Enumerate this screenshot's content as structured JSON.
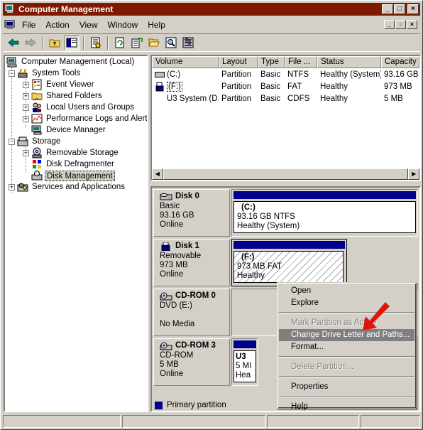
{
  "window": {
    "title": "Computer Management"
  },
  "menu": {
    "items": [
      "File",
      "Action",
      "View",
      "Window",
      "Help"
    ]
  },
  "toolbar": {
    "icons": [
      "back-icon",
      "forward-icon",
      "up-folder-icon",
      "show-hide-tree-icon",
      "properties-icon",
      "refresh-icon",
      "export-list-icon",
      "open-icon",
      "search-icon",
      "settings-icon"
    ]
  },
  "tree": {
    "root": "Computer Management (Local)",
    "system_tools": "System Tools",
    "event_viewer": "Event Viewer",
    "shared_folders": "Shared Folders",
    "local_users": "Local Users and Groups",
    "perf_logs": "Performance Logs and Alerts",
    "device_manager": "Device Manager",
    "storage": "Storage",
    "removable_storage": "Removable Storage",
    "disk_defrag": "Disk Defragmenter",
    "disk_mgmt": "Disk Management",
    "services_apps": "Services and Applications"
  },
  "volumes": {
    "columns": [
      "Volume",
      "Layout",
      "Type",
      "File ...",
      "Status",
      "Capacity"
    ],
    "rows": [
      {
        "volume": "(C:)",
        "layout": "Partition",
        "type": "Basic",
        "fs": "NTFS",
        "status": "Healthy (System)",
        "capacity": "93.16 GB"
      },
      {
        "volume": "(F:)",
        "layout": "Partition",
        "type": "Basic",
        "fs": "FAT",
        "status": "Healthy",
        "capacity": "973 MB"
      },
      {
        "volume": "U3 System (D:)",
        "layout": "Partition",
        "type": "Basic",
        "fs": "CDFS",
        "status": "Healthy",
        "capacity": "5 MB"
      }
    ]
  },
  "disks": {
    "d0": {
      "name": "Disk 0",
      "kind": "Basic",
      "size": "93.16 GB",
      "state": "Online",
      "part_title": "(C:)",
      "part_size": "93.16 GB NTFS",
      "part_status": "Healthy (System)"
    },
    "d1": {
      "name": "Disk 1",
      "kind": "Removable",
      "size": "973 MB",
      "state": "Online",
      "part_title": "(F:)",
      "part_size": "973 MB FAT",
      "part_status": "Healthy"
    },
    "cd0": {
      "name": "CD-ROM 0",
      "kind": "DVD (E:)",
      "state": "No Media"
    },
    "cd3": {
      "name": "CD-ROM 3",
      "kind": "CD-ROM",
      "size": "5 MB",
      "state": "Online",
      "part_title": "U3",
      "part_size": "5 MI",
      "part_status": "Hea"
    }
  },
  "legend": {
    "primary": "Primary partition"
  },
  "context_menu": {
    "open": "Open",
    "explore": "Explore",
    "mark_active": "Mark Partition as Active",
    "change_letter": "Change Drive Letter and Paths...",
    "format": "Format...",
    "delete": "Delete Partition...",
    "properties": "Properties",
    "help": "Help"
  },
  "colors": {
    "titlebar": "#7f1a00",
    "partition": "#00008b",
    "arrow": "#e0140c",
    "highlight": "#7f7f7f"
  }
}
